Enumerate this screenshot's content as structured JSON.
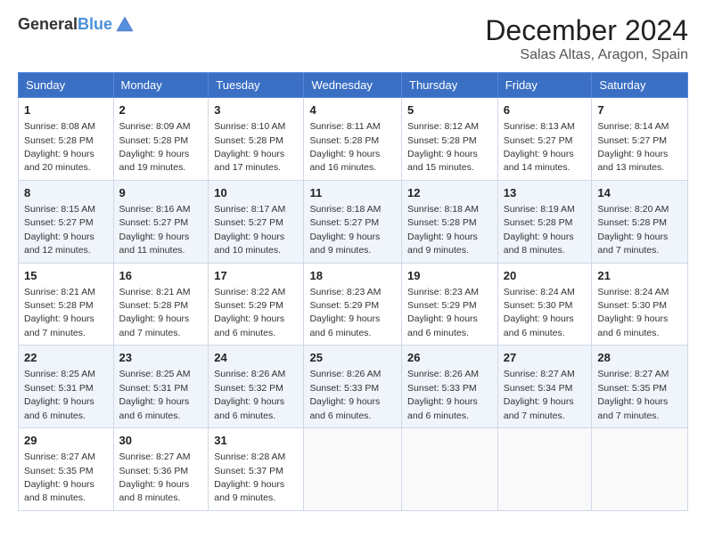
{
  "header": {
    "logo_line1": "General",
    "logo_line2": "Blue",
    "month": "December 2024",
    "location": "Salas Altas, Aragon, Spain"
  },
  "weekdays": [
    "Sunday",
    "Monday",
    "Tuesday",
    "Wednesday",
    "Thursday",
    "Friday",
    "Saturday"
  ],
  "weeks": [
    [
      {
        "day": "1",
        "info": "Sunrise: 8:08 AM\nSunset: 5:28 PM\nDaylight: 9 hours and 20 minutes."
      },
      {
        "day": "2",
        "info": "Sunrise: 8:09 AM\nSunset: 5:28 PM\nDaylight: 9 hours and 19 minutes."
      },
      {
        "day": "3",
        "info": "Sunrise: 8:10 AM\nSunset: 5:28 PM\nDaylight: 9 hours and 17 minutes."
      },
      {
        "day": "4",
        "info": "Sunrise: 8:11 AM\nSunset: 5:28 PM\nDaylight: 9 hours and 16 minutes."
      },
      {
        "day": "5",
        "info": "Sunrise: 8:12 AM\nSunset: 5:28 PM\nDaylight: 9 hours and 15 minutes."
      },
      {
        "day": "6",
        "info": "Sunrise: 8:13 AM\nSunset: 5:27 PM\nDaylight: 9 hours and 14 minutes."
      },
      {
        "day": "7",
        "info": "Sunrise: 8:14 AM\nSunset: 5:27 PM\nDaylight: 9 hours and 13 minutes."
      }
    ],
    [
      {
        "day": "8",
        "info": "Sunrise: 8:15 AM\nSunset: 5:27 PM\nDaylight: 9 hours and 12 minutes."
      },
      {
        "day": "9",
        "info": "Sunrise: 8:16 AM\nSunset: 5:27 PM\nDaylight: 9 hours and 11 minutes."
      },
      {
        "day": "10",
        "info": "Sunrise: 8:17 AM\nSunset: 5:27 PM\nDaylight: 9 hours and 10 minutes."
      },
      {
        "day": "11",
        "info": "Sunrise: 8:18 AM\nSunset: 5:27 PM\nDaylight: 9 hours and 9 minutes."
      },
      {
        "day": "12",
        "info": "Sunrise: 8:18 AM\nSunset: 5:28 PM\nDaylight: 9 hours and 9 minutes."
      },
      {
        "day": "13",
        "info": "Sunrise: 8:19 AM\nSunset: 5:28 PM\nDaylight: 9 hours and 8 minutes."
      },
      {
        "day": "14",
        "info": "Sunrise: 8:20 AM\nSunset: 5:28 PM\nDaylight: 9 hours and 7 minutes."
      }
    ],
    [
      {
        "day": "15",
        "info": "Sunrise: 8:21 AM\nSunset: 5:28 PM\nDaylight: 9 hours and 7 minutes."
      },
      {
        "day": "16",
        "info": "Sunrise: 8:21 AM\nSunset: 5:28 PM\nDaylight: 9 hours and 7 minutes."
      },
      {
        "day": "17",
        "info": "Sunrise: 8:22 AM\nSunset: 5:29 PM\nDaylight: 9 hours and 6 minutes."
      },
      {
        "day": "18",
        "info": "Sunrise: 8:23 AM\nSunset: 5:29 PM\nDaylight: 9 hours and 6 minutes."
      },
      {
        "day": "19",
        "info": "Sunrise: 8:23 AM\nSunset: 5:29 PM\nDaylight: 9 hours and 6 minutes."
      },
      {
        "day": "20",
        "info": "Sunrise: 8:24 AM\nSunset: 5:30 PM\nDaylight: 9 hours and 6 minutes."
      },
      {
        "day": "21",
        "info": "Sunrise: 8:24 AM\nSunset: 5:30 PM\nDaylight: 9 hours and 6 minutes."
      }
    ],
    [
      {
        "day": "22",
        "info": "Sunrise: 8:25 AM\nSunset: 5:31 PM\nDaylight: 9 hours and 6 minutes."
      },
      {
        "day": "23",
        "info": "Sunrise: 8:25 AM\nSunset: 5:31 PM\nDaylight: 9 hours and 6 minutes."
      },
      {
        "day": "24",
        "info": "Sunrise: 8:26 AM\nSunset: 5:32 PM\nDaylight: 9 hours and 6 minutes."
      },
      {
        "day": "25",
        "info": "Sunrise: 8:26 AM\nSunset: 5:33 PM\nDaylight: 9 hours and 6 minutes."
      },
      {
        "day": "26",
        "info": "Sunrise: 8:26 AM\nSunset: 5:33 PM\nDaylight: 9 hours and 6 minutes."
      },
      {
        "day": "27",
        "info": "Sunrise: 8:27 AM\nSunset: 5:34 PM\nDaylight: 9 hours and 7 minutes."
      },
      {
        "day": "28",
        "info": "Sunrise: 8:27 AM\nSunset: 5:35 PM\nDaylight: 9 hours and 7 minutes."
      }
    ],
    [
      {
        "day": "29",
        "info": "Sunrise: 8:27 AM\nSunset: 5:35 PM\nDaylight: 9 hours and 8 minutes."
      },
      {
        "day": "30",
        "info": "Sunrise: 8:27 AM\nSunset: 5:36 PM\nDaylight: 9 hours and 8 minutes."
      },
      {
        "day": "31",
        "info": "Sunrise: 8:28 AM\nSunset: 5:37 PM\nDaylight: 9 hours and 9 minutes."
      },
      null,
      null,
      null,
      null
    ]
  ]
}
